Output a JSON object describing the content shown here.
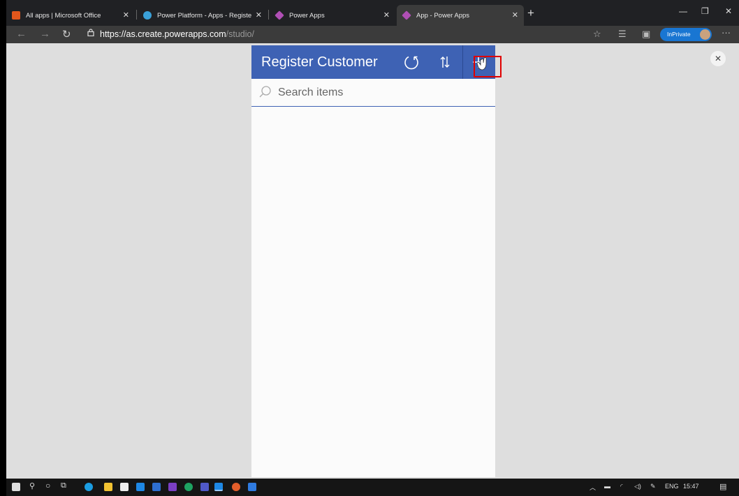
{
  "browser": {
    "tabs": [
      {
        "title": "All apps | Microsoft Office",
        "fav_color": "#e3571c",
        "active": false
      },
      {
        "title": "Power Platform - Apps - Registe",
        "fav_color": "#3aa0d8",
        "active": false
      },
      {
        "title": "Power Apps",
        "fav_color": "#b04fb5",
        "active": false
      },
      {
        "title": "App - Power Apps",
        "fav_color": "#b04fb5",
        "active": true
      }
    ],
    "url_main": "https://as.create.powerapps.com",
    "url_path": "/studio/",
    "inprivate_label": "InPrivate"
  },
  "app": {
    "title": "Register Customer",
    "search_placeholder": "Search items",
    "header_color": "#3e62b4"
  },
  "taskbar": {
    "language": "ENG",
    "time": "15:47"
  }
}
